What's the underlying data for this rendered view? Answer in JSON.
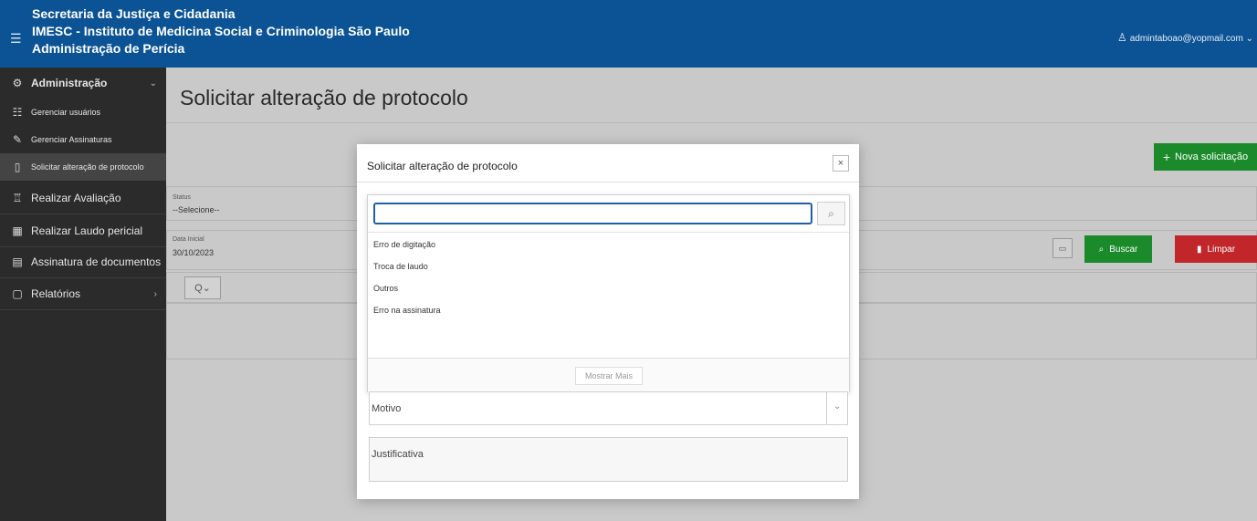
{
  "header": {
    "line1": "Secretaria da Justiça e Cidadania",
    "line2": "IMESC - Instituto de Medicina Social e Criminologia São Paulo",
    "line3": "Administração de Perícia",
    "user_email": "admintaboao@yopmail.com",
    "user_chevron": "⌄"
  },
  "sidebar": {
    "items": [
      {
        "label": "Administração",
        "icon": "gear-icon"
      },
      {
        "label": "Gerenciar usuários",
        "icon": "users-icon"
      },
      {
        "label": "Gerenciar Assinaturas",
        "icon": "pen-icon"
      },
      {
        "label": "Solicitar alteração de protocolo",
        "icon": "clipboard-edit-icon"
      },
      {
        "label": "Realizar Avaliação",
        "icon": "user-group-icon"
      },
      {
        "label": "Realizar Laudo pericial",
        "icon": "calendar-check-icon"
      },
      {
        "label": "Assinatura de documentos",
        "icon": "signature-icon"
      },
      {
        "label": "Relatórios",
        "icon": "clipboard-icon"
      }
    ],
    "chev_down": "⌄",
    "chev_right": "›"
  },
  "main": {
    "page_title": "Solicitar alteração de protocolo",
    "nova_label": "Nova solicitação",
    "status_label": "Status",
    "status_value": "--Selecione--",
    "data_inicial_label": "Data Inicial",
    "data_inicial_value": "30/10/2023",
    "buscar_label": "Buscar",
    "limpar_label": "Limpar",
    "search_dropdown": "Q⌄"
  },
  "modal": {
    "title": "Solicitar alteração de protocolo",
    "close": "×",
    "search_value": "",
    "options": [
      "Erro de digitação",
      "Troca de laudo",
      "Outros",
      "Erro na assinatura"
    ],
    "mostrar_mais": "Mostrar Mais",
    "motivo_placeholder": "Motivo",
    "justificativa_placeholder": "Justificativa"
  },
  "colors": {
    "header": "#0b5394",
    "sidebar": "#2b2b2b",
    "success": "#1a8a2a",
    "danger": "#c0262a",
    "focus": "#1f5fa8"
  }
}
